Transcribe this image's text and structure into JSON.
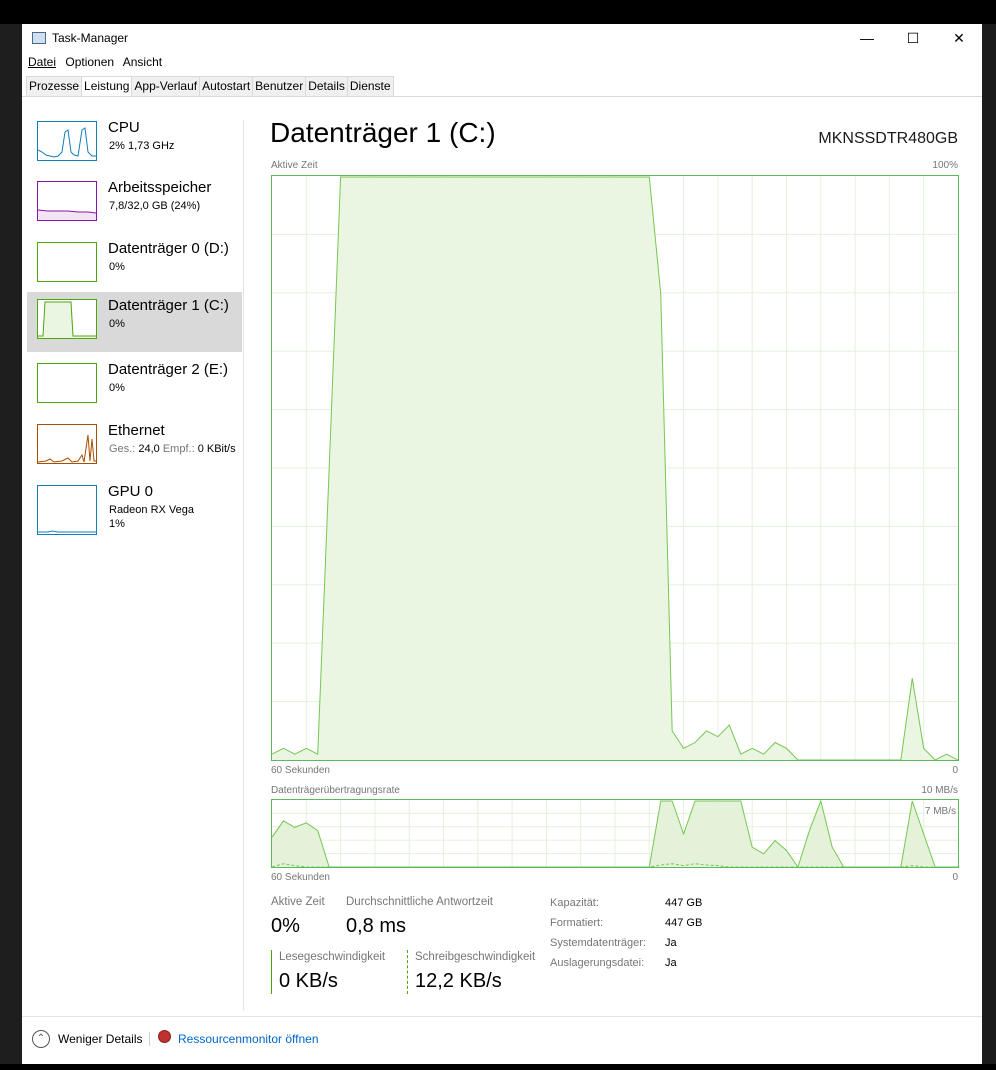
{
  "window": {
    "title": "Task-Manager",
    "minimize_glyph": "—",
    "maximize_glyph": "☐",
    "close_glyph": "✕"
  },
  "menu": [
    "Datei",
    "Optionen",
    "Ansicht"
  ],
  "tabs": [
    "Prozesse",
    "Leistung",
    "App-Verlauf",
    "Autostart",
    "Benutzer",
    "Details",
    "Dienste"
  ],
  "sidebar": {
    "cpu": {
      "name": "CPU",
      "sub": "2% 1,73 GHz",
      "color": "#117dbb"
    },
    "memory": {
      "name": "Arbeitsspeicher",
      "sub": "7,8/32,0 GB (24%)",
      "color": "#8b12ae"
    },
    "disk0": {
      "name": "Datenträger 0 (D:)",
      "sub": "0%",
      "color": "#4da60c"
    },
    "disk1": {
      "name": "Datenträger 1 (C:)",
      "sub": "0%",
      "color": "#4da60c"
    },
    "disk2": {
      "name": "Datenträger 2 (E:)",
      "sub": "0%",
      "color": "#4da60c"
    },
    "ethernet": {
      "name": "Ethernet",
      "send_label": "Ges.:",
      "send_value": "24,0",
      "recv_label": "Empf.:",
      "recv_value": "0 KBit/s",
      "color": "#a74f01"
    },
    "gpu": {
      "name": "GPU 0",
      "model": "Radeon RX Vega",
      "sub": "1%",
      "color": "#117dbb"
    }
  },
  "main": {
    "title": "Datenträger 1 (C:)",
    "model": "MKNSSDTR480GB",
    "chart1_label": "Aktive Zeit",
    "chart1_max": "100%",
    "chart1_time_left": "60 Sekunden",
    "chart1_time_right": "0",
    "chart2_label": "Datenträgerübertragungsrate",
    "chart2_max": "10 MB/s",
    "chart2_secondary": "7 MB/s",
    "chart2_time_left": "60 Sekunden",
    "chart2_time_right": "0"
  },
  "stats": {
    "active_time_label": "Aktive Zeit",
    "active_time_value": "0%",
    "response_label": "Durchschnittliche Antwortzeit",
    "response_value": "0,8 ms",
    "read_label": "Lesegeschwindigkeit",
    "read_value": "0 KB/s",
    "write_label": "Schreibgeschwindigkeit",
    "write_value": "12,2 KB/s",
    "details": [
      {
        "label": "Kapazität:",
        "value": "447 GB"
      },
      {
        "label": "Formatiert:",
        "value": "447 GB"
      },
      {
        "label": "Systemdatenträger:",
        "value": "Ja"
      },
      {
        "label": "Auslagerungsdatei:",
        "value": "Ja"
      }
    ]
  },
  "footer": {
    "fewer_details": "Weniger Details",
    "resource_monitor": "Ressourcenmonitor öffnen"
  },
  "chart_data": [
    {
      "type": "area",
      "title": "Aktive Zeit",
      "xlabel": "60 Sekunden",
      "ylim": [
        0,
        100
      ],
      "x": [
        60,
        59,
        58,
        57,
        56,
        55,
        54,
        53,
        52,
        51,
        50,
        49,
        48,
        47,
        46,
        45,
        44,
        43,
        42,
        41,
        40,
        39,
        38,
        37,
        36,
        35,
        34,
        33,
        32,
        31,
        30,
        29,
        28,
        27,
        26,
        25,
        24,
        23,
        22,
        21,
        20,
        19,
        18,
        17,
        16,
        15,
        14,
        13,
        12,
        11,
        10,
        9,
        8,
        7,
        6,
        5,
        4,
        3,
        2,
        1,
        0
      ],
      "y": [
        1,
        2,
        1,
        2,
        1,
        50,
        100,
        100,
        100,
        100,
        100,
        100,
        100,
        100,
        100,
        100,
        100,
        100,
        100,
        100,
        100,
        100,
        100,
        100,
        100,
        100,
        100,
        100,
        100,
        100,
        100,
        100,
        100,
        100,
        80,
        5,
        2,
        3,
        5,
        4,
        6,
        1,
        2,
        1,
        3,
        2,
        0,
        0,
        0,
        0,
        0,
        0,
        0,
        0,
        0,
        0,
        14,
        2,
        0,
        1,
        0
      ]
    },
    {
      "type": "area",
      "title": "Datenträgerübertragungsrate",
      "xlabel": "60 Sekunden",
      "series": [
        {
          "values": [
            4.5,
            7.0,
            6.0,
            6.7,
            5.5,
            0,
            0,
            0,
            0,
            0,
            0,
            0,
            0,
            0,
            0,
            0,
            0,
            0,
            0,
            0,
            0,
            0,
            0,
            0,
            0,
            0,
            0,
            0,
            0,
            0,
            0,
            0,
            0,
            0,
            10.0,
            10.0,
            5.0,
            10.0,
            10.0,
            10.0,
            10.0,
            10.0,
            3.0,
            2.0,
            4.0,
            2.5,
            0,
            5.5,
            10.0,
            3.0,
            0,
            0,
            0,
            0,
            0,
            0,
            10.0,
            5.0,
            0,
            0,
            0
          ]
        },
        {
          "values": [
            0,
            0.5,
            0.2,
            0,
            0,
            0,
            0,
            0,
            0,
            0,
            0,
            0,
            0,
            0,
            0,
            0,
            0,
            0,
            0,
            0,
            0,
            0,
            0,
            0,
            0,
            0,
            0,
            0,
            0,
            0,
            0,
            0,
            0,
            0,
            0.3,
            0.5,
            0.2,
            0.5,
            0.3,
            0.2,
            0,
            0,
            0,
            0,
            0,
            0,
            0,
            0,
            0,
            0,
            0,
            0,
            0,
            0,
            0,
            0,
            0.2,
            0,
            0,
            0,
            0
          ]
        }
      ]
    }
  ]
}
